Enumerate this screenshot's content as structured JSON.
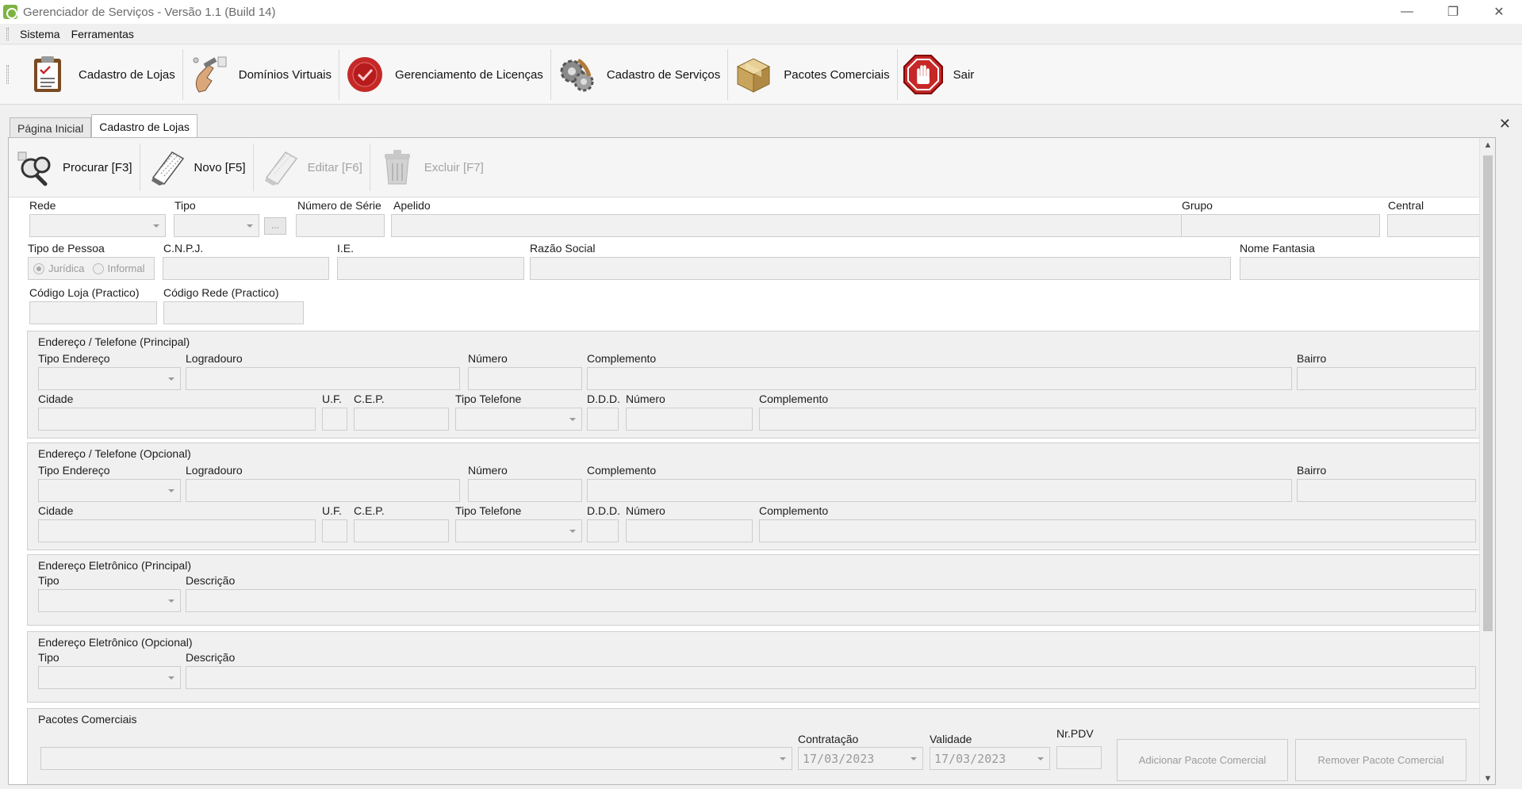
{
  "window": {
    "title": "Gerenciador de Serviços - Versão 1.1 (Build 14)",
    "minimize": "—",
    "restore": "❐",
    "close": "✕"
  },
  "menu": [
    "Sistema",
    "Ferramentas"
  ],
  "toolbar": [
    {
      "label": "Cadastro de Lojas",
      "icon": "clipboard-icon"
    },
    {
      "label": "Domínios Virtuais",
      "icon": "hand-plug-icon"
    },
    {
      "label": "Gerenciamento de Licenças",
      "icon": "wax-seal-icon"
    },
    {
      "label": "Cadastro de Serviços",
      "icon": "gears-icon"
    },
    {
      "label": "Pacotes Comerciais",
      "icon": "package-icon"
    },
    {
      "label": "Sair",
      "icon": "stop-hand-icon"
    }
  ],
  "tabs": {
    "items": [
      "Página Inicial",
      "Cadastro de Lojas"
    ],
    "active": "Cadastro de Lojas",
    "close": "✕"
  },
  "subtoolbar": [
    {
      "label": "Procurar [F3]",
      "icon": "binoculars-icon",
      "enabled": true
    },
    {
      "label": "Novo [F5]",
      "icon": "notepad-icon",
      "enabled": true
    },
    {
      "label": "Editar [F6]",
      "icon": "notepad-edit-icon",
      "enabled": false
    },
    {
      "label": "Excluir [F7]",
      "icon": "trash-icon",
      "enabled": false
    }
  ],
  "form": {
    "rede": "Rede",
    "tipo": "Tipo",
    "tipo_button": "...",
    "numero_serie": "Número de Série",
    "apelido": "Apelido",
    "grupo": "Grupo",
    "central": "Central",
    "tipo_pessoa": "Tipo de Pessoa",
    "juridica": "Jurídica",
    "informal": "Informal",
    "cnpj": "C.N.P.J.",
    "ie": "I.E.",
    "razao_social": "Razão Social",
    "nome_fantasia": "Nome Fantasia",
    "codigo_loja": "Código Loja (Practico)",
    "codigo_rede": "Código Rede (Practico)"
  },
  "address_labels": {
    "tipo_endereco": "Tipo Endereço",
    "logradouro": "Logradouro",
    "numero": "Número",
    "complemento": "Complemento",
    "bairro": "Bairro",
    "cidade": "Cidade",
    "uf": "U.F.",
    "cep": "C.E.P.",
    "tipo_telefone": "Tipo Telefone",
    "ddd": "D.D.D."
  },
  "groups": {
    "end_principal": "Endereço / Telefone (Principal)",
    "end_opcional": "Endereço / Telefone (Opcional)",
    "ele_principal": "Endereço Eletrônico (Principal)",
    "ele_opcional": "Endereço Eletrônico (Opcional)",
    "pacotes": "Pacotes Comerciais"
  },
  "electronic_labels": {
    "tipo": "Tipo",
    "descricao": "Descrição"
  },
  "pacotes": {
    "contratacao": "Contratação",
    "contratacao_value": "17/03/2023",
    "validade": "Validade",
    "validade_value": "17/03/2023",
    "nr_pdv": "Nr.PDV",
    "add_button": "Adicionar Pacote Comercial",
    "remove_button": "Remover Pacote Comercial"
  },
  "scrollbar": {
    "up": "▲",
    "down": "▼"
  }
}
